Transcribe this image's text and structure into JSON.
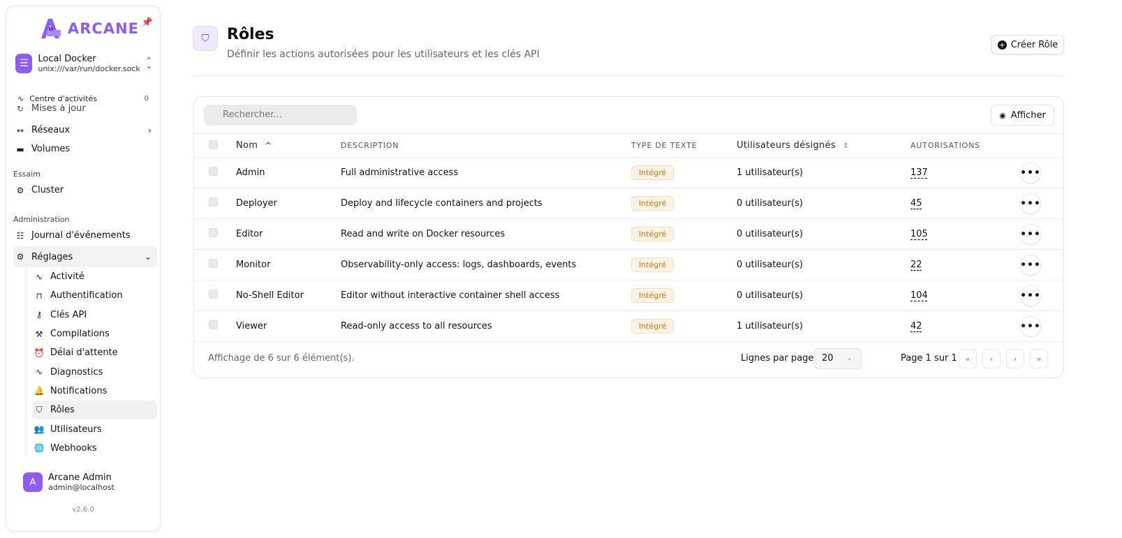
{
  "brand": {
    "name": "ARCANE"
  },
  "environment": {
    "name": "Local Docker",
    "socket": "unix:///var/run/docker.sock"
  },
  "activity_center": {
    "label": "Centre d'activités",
    "count": "0"
  },
  "nav": {
    "clipped_item": "Mises à jour",
    "networks": "Réseaux",
    "volumes": "Volumes",
    "swarm_section": "Essaim",
    "cluster": "Cluster",
    "admin_section": "Administration",
    "event_log": "Journal d'événements",
    "settings": "Réglages",
    "settings_items": [
      {
        "label": "Activité",
        "icon": "activity-icon"
      },
      {
        "label": "Authentification",
        "icon": "lock-icon"
      },
      {
        "label": "Clés API",
        "icon": "key-icon"
      },
      {
        "label": "Compilations",
        "icon": "hammer-icon"
      },
      {
        "label": "Délai d'attente",
        "icon": "alarm-icon"
      },
      {
        "label": "Diagnostics",
        "icon": "pulse-icon"
      },
      {
        "label": "Notifications",
        "icon": "bell-icon"
      },
      {
        "label": "Rôles",
        "icon": "shield-icon"
      },
      {
        "label": "Utilisateurs",
        "icon": "users-icon"
      },
      {
        "label": "Webhooks",
        "icon": "globe-icon"
      }
    ]
  },
  "user": {
    "initial": "A",
    "name": "Arcane Admin",
    "email": "admin@localhost"
  },
  "version": "v2.6.0",
  "header": {
    "title": "Rôles",
    "subtitle": "Définir les actions autorisées pour les utilisateurs et les clés API",
    "create_label": "Créer Rôle"
  },
  "toolbar": {
    "search_placeholder": "Rechercher...",
    "show_label": "Afficher"
  },
  "table": {
    "columns": {
      "name": "Nom",
      "description": "DESCRIPTION",
      "type": "TYPE DE TEXTE",
      "users": "Utilisateurs désignés",
      "permissions": "AUTORISATIONS"
    },
    "rows": [
      {
        "name": "Admin",
        "description": "Full administrative access",
        "type": "Intégré",
        "users": "1 utilisateur(s)",
        "permissions": "137"
      },
      {
        "name": "Deployer",
        "description": "Deploy and lifecycle containers and projects",
        "type": "Intégré",
        "users": "0 utilisateur(s)",
        "permissions": "45"
      },
      {
        "name": "Editor",
        "description": "Read and write on Docker resources",
        "type": "Intégré",
        "users": "0 utilisateur(s)",
        "permissions": "105"
      },
      {
        "name": "Monitor",
        "description": "Observability-only access: logs, dashboards, events",
        "type": "Intégré",
        "users": "0 utilisateur(s)",
        "permissions": "22"
      },
      {
        "name": "No-Shell Editor",
        "description": "Editor without interactive container shell access",
        "type": "Intégré",
        "users": "0 utilisateur(s)",
        "permissions": "104"
      },
      {
        "name": "Viewer",
        "description": "Read-only access to all resources",
        "type": "Intégré",
        "users": "1 utilisateur(s)",
        "permissions": "42"
      }
    ]
  },
  "footer": {
    "count_text": "Affichage de 6 sur 6 élément(s).",
    "rows_per_page_label": "Lignes par page",
    "rows_per_page_value": "20",
    "page_info": "Page 1 sur 1"
  },
  "colors": {
    "accent": "#8b5cf6",
    "badge_bg": "#fdf2e4",
    "badge_text": "#c77717"
  }
}
